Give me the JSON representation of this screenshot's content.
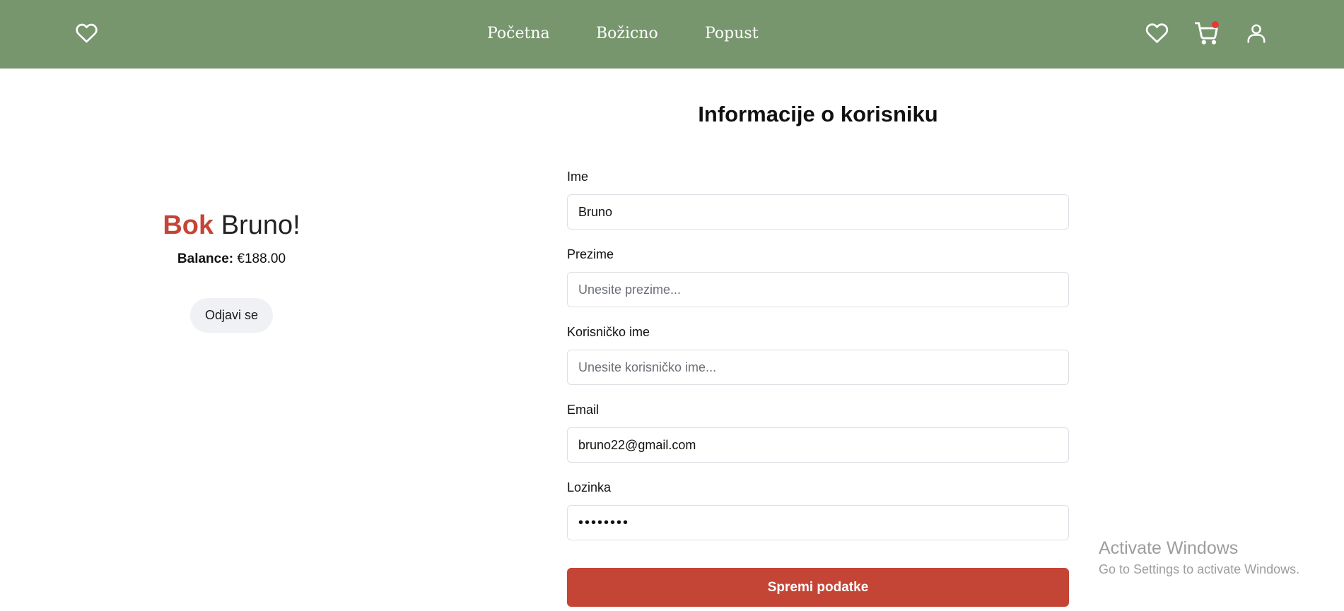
{
  "colors": {
    "header_bg": "#77966d",
    "accent_red": "#c44536",
    "cart_badge": "#e53935"
  },
  "header": {
    "logo_icon": "heart-outline-icon",
    "nav": [
      {
        "label": "Početna"
      },
      {
        "label": "Božicno"
      },
      {
        "label": "Popust"
      }
    ],
    "icons": [
      "heart-outline-icon",
      "cart-icon",
      "user-icon"
    ]
  },
  "profile": {
    "greeting_word": "Bok",
    "user_name": "Bruno!",
    "balance_label": "Balance:",
    "balance_value": "€188.00",
    "logout_label": "Odjavi se"
  },
  "form": {
    "title": "Informacije o korisniku",
    "fields": [
      {
        "label": "Ime",
        "value": "Bruno",
        "placeholder": ""
      },
      {
        "label": "Prezime",
        "value": "",
        "placeholder": "Unesite prezime..."
      },
      {
        "label": "Korisničko ime",
        "value": "",
        "placeholder": "Unesite korisničko ime..."
      },
      {
        "label": "Email",
        "value": "bruno22@gmail.com",
        "placeholder": ""
      },
      {
        "label": "Lozinka",
        "value": "bruno123",
        "placeholder": ""
      }
    ],
    "submit_label": "Spremi podatke"
  },
  "watermark": {
    "title": "Activate Windows",
    "subtitle": "Go to Settings to activate Windows."
  }
}
